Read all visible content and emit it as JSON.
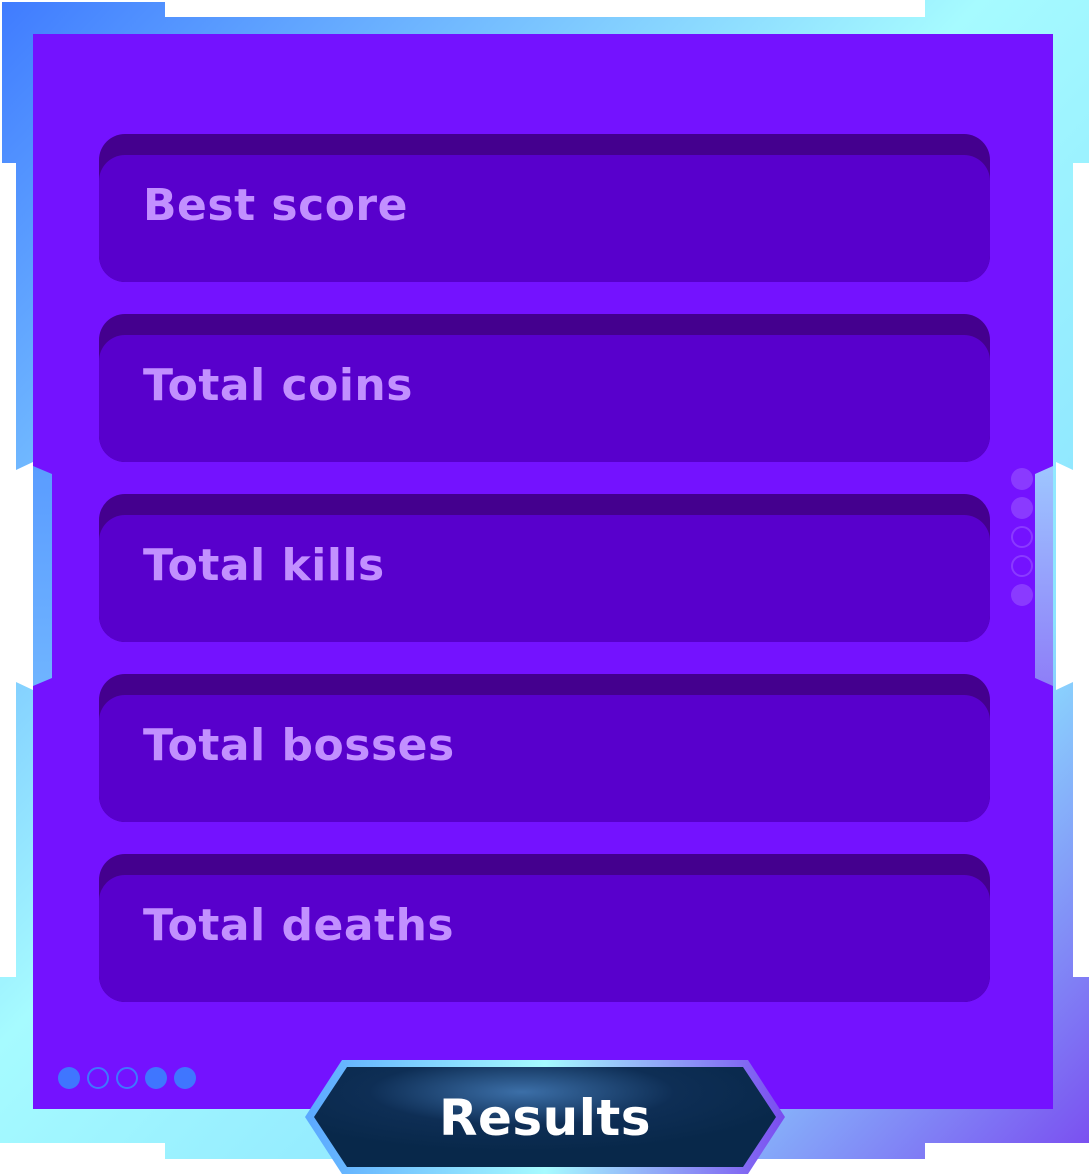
{
  "stats": [
    {
      "label": "Best score"
    },
    {
      "label": "Total coins"
    },
    {
      "label": "Total kills"
    },
    {
      "label": "Total bosses"
    },
    {
      "label": "Total deaths"
    }
  ],
  "results_button": {
    "label": "Results"
  },
  "pager_bottom": {
    "dots": [
      "filled",
      "hollow",
      "hollow",
      "filled",
      "filled"
    ]
  },
  "pager_right": {
    "dots": [
      "filled",
      "filled",
      "hollow",
      "hollow",
      "filled"
    ]
  },
  "colors": {
    "panel": "#7412FF",
    "row_face": "#5800CC",
    "row_shadow": "#44008E",
    "label": "#C290FF",
    "frame_blue": "#3F7BFF",
    "frame_cyan": "#A6FBFF",
    "frame_violet": "#7A4CF0",
    "button_dark": "#08284A"
  }
}
